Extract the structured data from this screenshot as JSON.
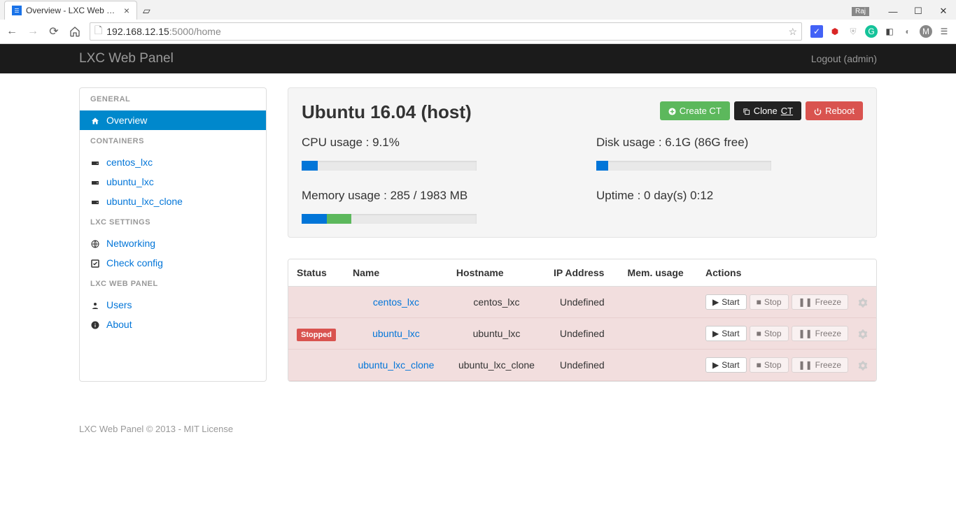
{
  "browser": {
    "tab_title": "Overview - LXC Web Pane",
    "url_host": "192.168.12.15",
    "url_port_path": ":5000/home",
    "user_badge": "Raj"
  },
  "navbar": {
    "brand": "LXC Web Panel",
    "logout_label": "Logout (admin)"
  },
  "sidebar": {
    "sections": {
      "general": "GENERAL",
      "containers": "CONTAINERS",
      "settings": "LXC SETTINGS",
      "webpanel": "LXC WEB PANEL"
    },
    "overview": "Overview",
    "containers_list": [
      "centos_lxc",
      "ubuntu_lxc",
      "ubuntu_lxc_clone"
    ],
    "networking": "Networking",
    "check_config": "Check config",
    "users": "Users",
    "about": "About"
  },
  "host_panel": {
    "title": "Ubuntu 16.04 (host)",
    "create_btn": "Create CT",
    "clone_btn": "Clone",
    "clone_suffix": "CT",
    "reboot_btn": "Reboot",
    "cpu_label": "CPU usage : 9.1%",
    "disk_label": "Disk usage : 6.1G (86G free)",
    "mem_label": "Memory usage : 285 / 1983 MB",
    "uptime_label": "Uptime : 0 day(s) 0:12"
  },
  "table": {
    "headers": {
      "status": "Status",
      "name": "Name",
      "hostname": "Hostname",
      "ip": "IP Address",
      "mem": "Mem. usage",
      "actions": "Actions"
    },
    "status_stopped": "Stopped",
    "undefined": "Undefined",
    "rows": [
      {
        "name": "centos_lxc",
        "hostname": "centos_lxc",
        "ip": "Undefined",
        "show_status": false
      },
      {
        "name": "ubuntu_lxc",
        "hostname": "ubuntu_lxc",
        "ip": "Undefined",
        "show_status": true
      },
      {
        "name": "ubuntu_lxc_clone",
        "hostname": "ubuntu_lxc_clone",
        "ip": "Undefined",
        "show_status": false
      }
    ],
    "start": "Start",
    "stop": "Stop",
    "freeze": "Freeze"
  },
  "footer": "LXC Web Panel © 2013 - MIT License",
  "chart_data": {
    "type": "bar",
    "title": "Host resource usage",
    "series": [
      {
        "name": "CPU usage",
        "value_pct": 9.1,
        "display": "9.1%"
      },
      {
        "name": "Disk usage",
        "used_gb": 6.1,
        "free_gb": 86,
        "value_pct": 6.6
      },
      {
        "name": "Memory usage",
        "used_mb": 285,
        "total_mb": 1983,
        "value_pct": 14.4,
        "segments": [
          {
            "color": "blue",
            "pct": 14.4
          },
          {
            "color": "green",
            "pct": 14.0
          }
        ]
      }
    ]
  }
}
